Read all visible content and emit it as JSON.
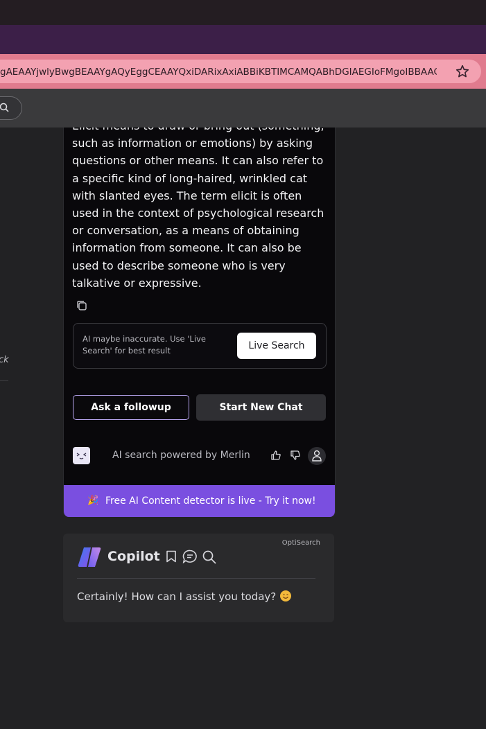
{
  "browser": {
    "url": "gAEAAYjwlyBwgBEAAYgAQyEggCEAAYQxiDARixAxiABBiKBTIMCAMQABhDGIAEGIoFMgoIBBAAGLE..."
  },
  "sidebar": {
    "partial_text": "ck"
  },
  "merlin": {
    "answer_text": "Elicit means to draw or bring out (something, such as information or emotions) by asking questions or other means. It can also refer to a specific kind of long-haired, wrinkled cat with slanted eyes. The term elicit is often used in the context of psychological research or conversation, as a means of obtaining information from someone. It can also be used to describe someone who is very talkative or expressive.",
    "disclaimer": "AI maybe inaccurate. Use 'Live Search' for best result",
    "live_search_label": "Live Search",
    "followup_label": "Ask a followup",
    "new_chat_label": "Start New Chat",
    "powered_by": "AI search powered by Merlin",
    "promo": "Free AI Content detector is live - Try it now!",
    "colors": {
      "accent": "#7a4fe0",
      "card_bg": "#09080b"
    }
  },
  "copilot": {
    "badge": "OptiSearch",
    "title": "Copilot",
    "reply": "Certainly! How can I assist you today?"
  }
}
